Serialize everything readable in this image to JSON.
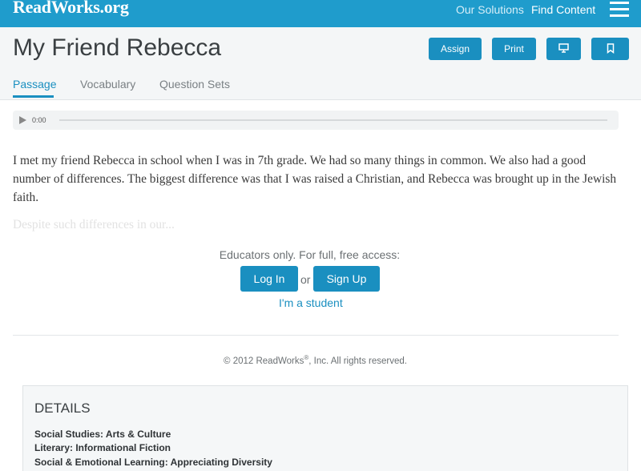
{
  "nav": {
    "logo": "ReadWorks.org",
    "links": [
      "Our Solutions",
      "Find Content"
    ]
  },
  "header": {
    "title": "My Friend Rebecca",
    "buttons": {
      "assign": "Assign",
      "print": "Print"
    },
    "tabs": [
      "Passage",
      "Vocabulary",
      "Question Sets"
    ]
  },
  "audio": {
    "time": "0:00"
  },
  "passage": {
    "text": "I met my friend Rebecca in school when I was in 7th grade. We had so many things in common. We also had a good number of differences. The biggest difference was that I was raised a Christian, and Rebecca was brought up in the Jewish faith.",
    "faded": "Despite such differences in our..."
  },
  "access": {
    "prompt": "Educators only. For full, free access:",
    "login": "Log In",
    "or": "or",
    "signup": "Sign Up",
    "student": "I'm a student"
  },
  "footer": {
    "copyright_pre": "© 2012 ReadWorks",
    "copyright_mark": "®",
    "copyright_post": ", Inc. All rights reserved."
  },
  "details": {
    "title": "DETAILS",
    "lines": [
      "Social Studies: Arts & Culture",
      "Literary: Informational Fiction",
      "Social & Emotional Learning: Appreciating Diversity"
    ]
  },
  "colors": {
    "brand": "#1f9ccc",
    "button": "#1a8fc0"
  },
  "icons": [
    "hamburger-menu-icon",
    "presentation-icon",
    "bookmark-icon",
    "play-icon"
  ]
}
